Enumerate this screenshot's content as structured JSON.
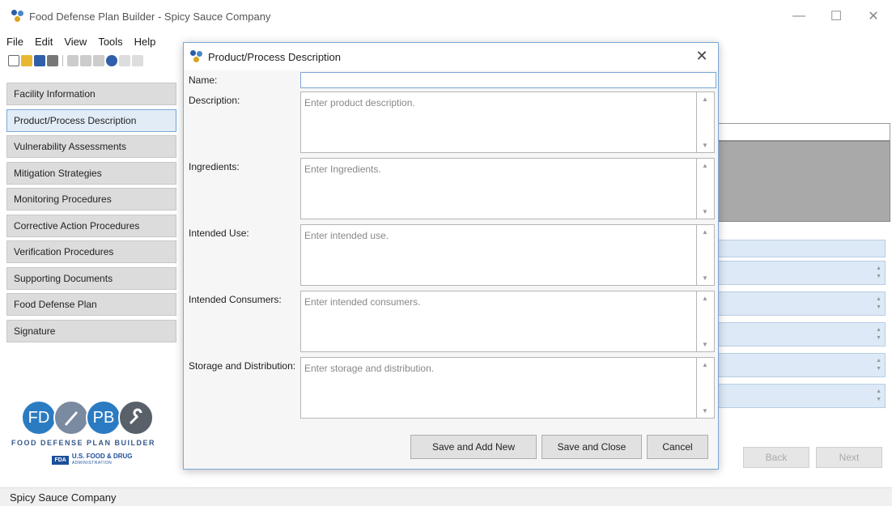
{
  "window": {
    "title": "Food Defense Plan Builder - Spicy Sauce Company",
    "minimize": "—",
    "maximize": "☐",
    "close": "✕"
  },
  "menu": [
    "File",
    "Edit",
    "View",
    "Tools",
    "Help"
  ],
  "nav": [
    {
      "label": "Facility Information",
      "active": false
    },
    {
      "label": "Product/Process Description",
      "active": true
    },
    {
      "label": "Vulnerability Assessments",
      "active": false
    },
    {
      "label": "Mitigation Strategies",
      "active": false
    },
    {
      "label": "Monitoring Procedures",
      "active": false
    },
    {
      "label": "Corrective Action Procedures",
      "active": false
    },
    {
      "label": "Verification Procedures",
      "active": false
    },
    {
      "label": "Supporting Documents",
      "active": false
    },
    {
      "label": "Food Defense Plan",
      "active": false
    },
    {
      "label": "Signature",
      "active": false
    }
  ],
  "logo": {
    "fd": "FD",
    "pb": "PB",
    "text": "FOOD DEFENSE PLAN BUILDER",
    "fda_badge": "FDA",
    "fda_name": "U.S. FOOD & DRUG",
    "fda_sub": "ADMINISTRATION"
  },
  "background": {
    "back_label": "Back",
    "next_label": "Next"
  },
  "dialog": {
    "title": "Product/Process Description",
    "close": "✕",
    "name_label": "Name:",
    "name_value": "",
    "fields": [
      {
        "label": "Description:",
        "placeholder": "Enter product description."
      },
      {
        "label": "Ingredients:",
        "placeholder": "Enter Ingredients."
      },
      {
        "label": "Intended Use:",
        "placeholder": "Enter intended use."
      },
      {
        "label": "Intended Consumers:",
        "placeholder": "Enter intended consumers."
      },
      {
        "label": "Storage and Distribution:",
        "placeholder": "Enter storage and distribution."
      }
    ],
    "buttons": {
      "save_add_new": "Save and Add New",
      "save_close": "Save and Close",
      "cancel": "Cancel"
    }
  },
  "status": {
    "text": "Spicy Sauce Company"
  }
}
